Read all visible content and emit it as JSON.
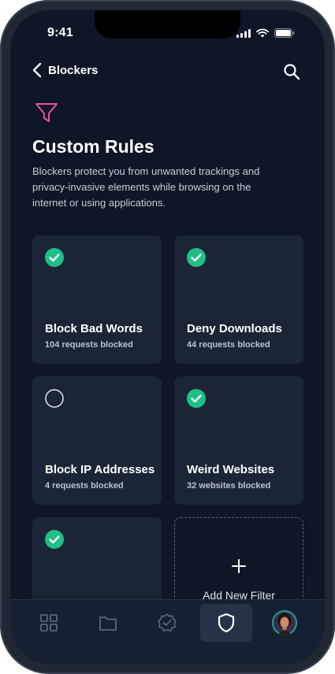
{
  "status": {
    "time": "9:41"
  },
  "header": {
    "back_label": "Blockers"
  },
  "page": {
    "title": "Custom Rules",
    "description": "Blockers protect you from unwanted trackings and privacy-invasive elements while browsing on the internet or using applications."
  },
  "filters": [
    {
      "name": "Block Bad Words",
      "detail": "104 requests blocked",
      "enabled": true
    },
    {
      "name": "Deny Downloads",
      "detail": "44 requests blocked",
      "enabled": true
    },
    {
      "name": "Block IP Addresses",
      "detail": "4 requests blocked",
      "enabled": false
    },
    {
      "name": "Weird Websites",
      "detail": "32 websites blocked",
      "enabled": true
    },
    {
      "name": "",
      "detail": "",
      "enabled": true
    }
  ],
  "add_filter": {
    "label": "Add New Filter"
  },
  "tabs": [
    {
      "icon": "grid-icon"
    },
    {
      "icon": "folder-icon"
    },
    {
      "icon": "badge-check-icon"
    },
    {
      "icon": "shield-icon",
      "active": true
    },
    {
      "icon": "avatar"
    }
  ],
  "colors": {
    "background": "#0f1626",
    "card": "#1c2535",
    "check_green": "#1fbf86",
    "filter_icon_pink": "#ec4fa0"
  }
}
